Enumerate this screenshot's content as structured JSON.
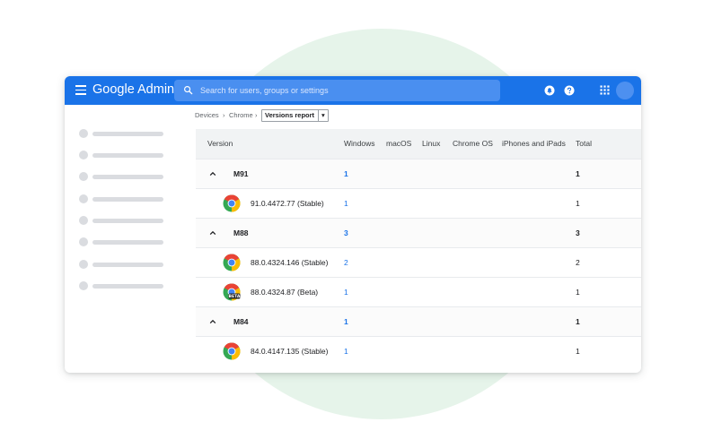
{
  "app": {
    "brand_google": "Google",
    "brand_product": "Admin",
    "search_placeholder": "Search for users, groups or settings"
  },
  "topbar_icons": [
    "menu-icon",
    "search-icon",
    "notifications-icon",
    "help-icon",
    "apps-grid-icon",
    "account-avatar"
  ],
  "breadcrumb": {
    "items": [
      "Devices",
      "Chrome"
    ],
    "separator": "›",
    "selected": "Versions report"
  },
  "table": {
    "columns": [
      "Version",
      "Windows",
      "macOS",
      "Linux",
      "Chrome OS",
      "iPhones and iPads",
      "Total"
    ],
    "rows": [
      {
        "type": "group",
        "name": "M91",
        "windows": "1",
        "total": "1"
      },
      {
        "type": "version",
        "name": "91.0.4472.77 (Stable)",
        "windows": "1",
        "total": "1",
        "channel": "stable"
      },
      {
        "type": "group",
        "name": "M88",
        "windows": "3",
        "total": "3"
      },
      {
        "type": "version",
        "name": "88.0.4324.146 (Stable)",
        "windows": "2",
        "total": "2",
        "channel": "stable"
      },
      {
        "type": "version",
        "name": "88.0.4324.87 (Beta)",
        "windows": "1",
        "total": "1",
        "channel": "beta"
      },
      {
        "type": "group",
        "name": "M84",
        "windows": "1",
        "total": "1"
      },
      {
        "type": "version",
        "name": "84.0.4147.135 (Stable)",
        "windows": "1",
        "total": "1",
        "channel": "stable"
      }
    ]
  },
  "colors": {
    "brand_blue": "#1a73e8",
    "chrome_red": "#ea4335",
    "chrome_yellow": "#fbbc04",
    "chrome_green": "#34a853",
    "chrome_center": "#4285f4",
    "beta_badge": "#202124",
    "background_circle": "#e6f4ea"
  }
}
